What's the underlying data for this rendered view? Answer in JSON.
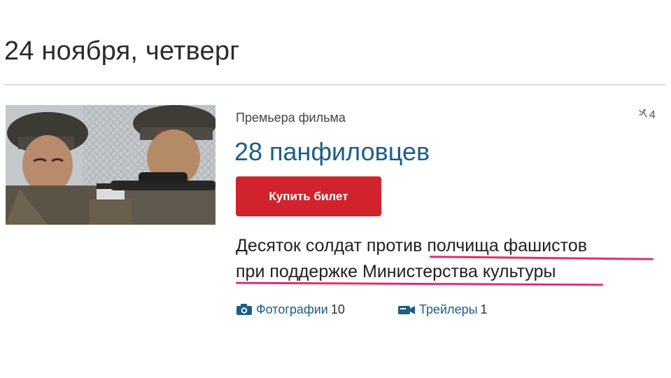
{
  "page": {
    "date_heading": "24 ноября, четверг"
  },
  "event": {
    "category_label": "Премьера фильма",
    "title": "28 панфиловцев",
    "rating_value": "4",
    "rating_icon": "figure-icon",
    "buy_button_label": "Купить билет",
    "description_line_1": "Десяток солдат против полчища фашистов",
    "description_line_2": "при поддержке Министерства культуры",
    "poster_image": "movie-still-soldiers"
  },
  "media": {
    "photos_label": "Фотографии",
    "photos_count": "10",
    "photos_icon": "camera-icon",
    "trailers_label": "Трейлеры",
    "trailers_count": "1",
    "trailers_icon": "video-camera-icon"
  },
  "colors": {
    "accent": "#1c5e87",
    "buy_button": "#d1232c",
    "highlight_underline": "#e0306a"
  }
}
